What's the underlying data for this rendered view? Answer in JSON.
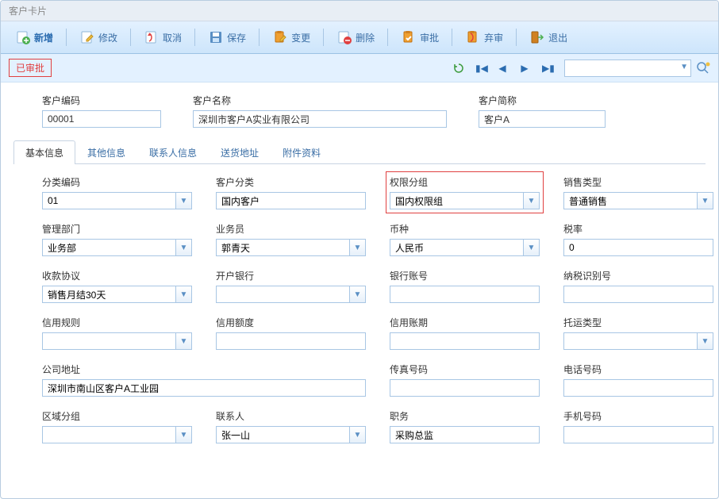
{
  "title": "客户卡片",
  "toolbar": {
    "add": "新增",
    "edit": "修改",
    "cancel": "取消",
    "save": "保存",
    "change": "变更",
    "delete": "删除",
    "approve": "审批",
    "reject": "弃审",
    "exit": "退出"
  },
  "status": "已审批",
  "header": {
    "code_label": "客户编码",
    "code": "00001",
    "name_label": "客户名称",
    "name": "深圳市客户A实业有限公司",
    "short_label": "客户简称",
    "short": "客户A"
  },
  "tabs": [
    "基本信息",
    "其他信息",
    "联系人信息",
    "送货地址",
    "附件资料"
  ],
  "form": {
    "category_code": {
      "label": "分类编码",
      "value": "01"
    },
    "customer_category": {
      "label": "客户分类",
      "value": "国内客户"
    },
    "perm_group": {
      "label": "权限分组",
      "value": "国内权限组"
    },
    "sales_type": {
      "label": "销售类型",
      "value": "普通销售"
    },
    "manage_dept": {
      "label": "管理部门",
      "value": "业务部"
    },
    "salesman": {
      "label": "业务员",
      "value": "郭青天"
    },
    "currency": {
      "label": "币种",
      "value": "人民币"
    },
    "tax_rate": {
      "label": "税率",
      "value": "0"
    },
    "receipt_agreement": {
      "label": "收款协议",
      "value": "销售月结30天"
    },
    "bank": {
      "label": "开户银行",
      "value": ""
    },
    "bank_account": {
      "label": "银行账号",
      "value": ""
    },
    "tax_id": {
      "label": "纳税识别号",
      "value": ""
    },
    "credit_rule": {
      "label": "信用规则",
      "value": ""
    },
    "credit_limit": {
      "label": "信用额度",
      "value": ""
    },
    "credit_period": {
      "label": "信用账期",
      "value": ""
    },
    "shipping_type": {
      "label": "托运类型",
      "value": ""
    },
    "company_address": {
      "label": "公司地址",
      "value": "深圳市南山区客户A工业园"
    },
    "fax": {
      "label": "传真号码",
      "value": ""
    },
    "phone": {
      "label": "电话号码",
      "value": ""
    },
    "area_group": {
      "label": "区域分组",
      "value": ""
    },
    "contact": {
      "label": "联系人",
      "value": "张一山"
    },
    "position": {
      "label": "职务",
      "value": "采购总监"
    },
    "mobile": {
      "label": "手机号码",
      "value": ""
    }
  },
  "search": {
    "placeholder": ""
  }
}
